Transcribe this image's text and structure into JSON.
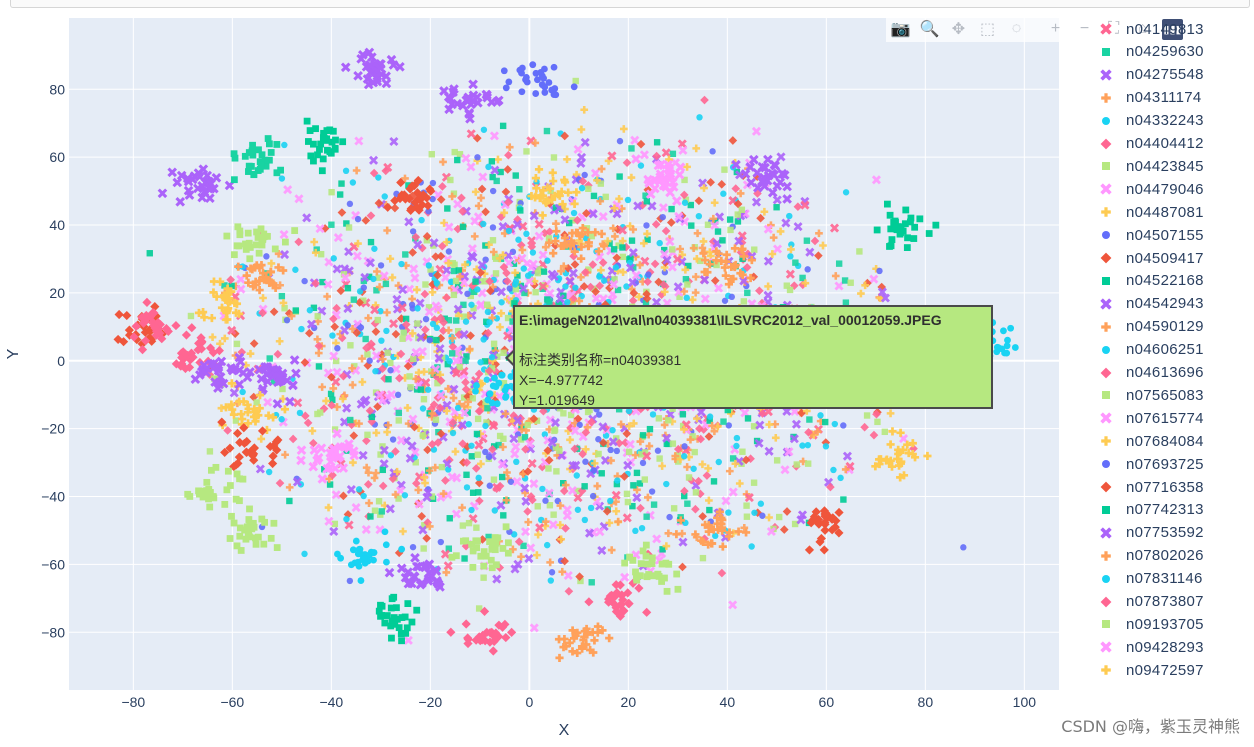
{
  "chart_data": {
    "type": "scatter",
    "xlabel": "X",
    "ylabel": "Y",
    "xlim": [
      -93,
      107
    ],
    "ylim": [
      -97,
      101
    ],
    "x_ticks": [
      -80,
      -60,
      -40,
      -20,
      0,
      20,
      40,
      60,
      80,
      100
    ],
    "y_ticks": [
      -80,
      -60,
      -40,
      -20,
      0,
      20,
      40,
      60,
      80
    ],
    "x_tick_labels": [
      "−80",
      "−60",
      "−40",
      "−20",
      "0",
      "20",
      "40",
      "60",
      "80",
      "100"
    ],
    "y_tick_labels": [
      "−80",
      "−60",
      "−40",
      "−20",
      "0",
      "20",
      "40",
      "60",
      "80"
    ],
    "grid": true,
    "legend_position": "right",
    "series": [
      {
        "name": "n04149813",
        "symbol": "x",
        "color": "#FF6692"
      },
      {
        "name": "n04259630",
        "symbol": "square",
        "color": "#19D3A2"
      },
      {
        "name": "n04275548",
        "symbol": "x",
        "color": "#AB63FA"
      },
      {
        "name": "n04311174",
        "symbol": "cross",
        "color": "#FFA15A"
      },
      {
        "name": "n04332243",
        "symbol": "circle",
        "color": "#19D3F3"
      },
      {
        "name": "n04404412",
        "symbol": "diamond",
        "color": "#FF6692"
      },
      {
        "name": "n04423845",
        "symbol": "square",
        "color": "#B6E880"
      },
      {
        "name": "n04479046",
        "symbol": "x",
        "color": "#FF97FF"
      },
      {
        "name": "n04487081",
        "symbol": "cross",
        "color": "#FECB52"
      },
      {
        "name": "n04507155",
        "symbol": "circle",
        "color": "#636EFA"
      },
      {
        "name": "n04509417",
        "symbol": "diamond",
        "color": "#EF553B"
      },
      {
        "name": "n04522168",
        "symbol": "square",
        "color": "#00CC96"
      },
      {
        "name": "n04542943",
        "symbol": "x",
        "color": "#AB63FA"
      },
      {
        "name": "n04590129",
        "symbol": "cross",
        "color": "#FFA15A"
      },
      {
        "name": "n04606251",
        "symbol": "circle",
        "color": "#19D3F3"
      },
      {
        "name": "n04613696",
        "symbol": "diamond",
        "color": "#FF6692"
      },
      {
        "name": "n07565083",
        "symbol": "square",
        "color": "#B6E880"
      },
      {
        "name": "n07615774",
        "symbol": "x",
        "color": "#FF97FF"
      },
      {
        "name": "n07684084",
        "symbol": "cross",
        "color": "#FECB52"
      },
      {
        "name": "n07693725",
        "symbol": "circle",
        "color": "#636EFA"
      },
      {
        "name": "n07716358",
        "symbol": "diamond",
        "color": "#EF553B"
      },
      {
        "name": "n07742313",
        "symbol": "square",
        "color": "#00CC96"
      },
      {
        "name": "n07753592",
        "symbol": "x",
        "color": "#AB63FA"
      },
      {
        "name": "n07802026",
        "symbol": "cross",
        "color": "#FFA15A"
      },
      {
        "name": "n07831146",
        "symbol": "circle",
        "color": "#19D3F3"
      },
      {
        "name": "n07873807",
        "symbol": "diamond",
        "color": "#FF6692"
      },
      {
        "name": "n09193705",
        "symbol": "square",
        "color": "#B6E880"
      },
      {
        "name": "n09428293",
        "symbol": "x",
        "color": "#FF97FF"
      },
      {
        "name": "n09472597",
        "symbol": "cross",
        "color": "#FECB52"
      }
    ],
    "clusters": [
      {
        "series": "n04509417",
        "x": -78,
        "y": 9
      },
      {
        "series": "n04613696",
        "x": -76,
        "y": 10
      },
      {
        "series": "n04404412",
        "x": -68,
        "y": 3
      },
      {
        "series": "n04275548",
        "x": -66,
        "y": 52
      },
      {
        "series": "n04259630",
        "x": -56,
        "y": 59
      },
      {
        "series": "n04522168",
        "x": -42,
        "y": 64
      },
      {
        "series": "n04275548",
        "x": -31,
        "y": 86
      },
      {
        "series": "n04507155",
        "x": 2,
        "y": 84
      },
      {
        "series": "n04275548",
        "x": -13,
        "y": 77
      },
      {
        "series": "n04509417",
        "x": -24,
        "y": 49
      },
      {
        "series": "n04423845",
        "x": -56,
        "y": 35
      },
      {
        "series": "n04311174",
        "x": -55,
        "y": 25
      },
      {
        "series": "n04487081",
        "x": -62,
        "y": 17
      },
      {
        "series": "n04542943",
        "x": -62,
        "y": -4
      },
      {
        "series": "n04542943",
        "x": -50,
        "y": -5
      },
      {
        "series": "n07684084",
        "x": -56,
        "y": -15
      },
      {
        "series": "n07716358",
        "x": -56,
        "y": -27
      },
      {
        "series": "n07565083",
        "x": -64,
        "y": -38
      },
      {
        "series": "n04423845",
        "x": -56,
        "y": -50
      },
      {
        "series": "n07615774",
        "x": -40,
        "y": -28
      },
      {
        "series": "n04332243",
        "x": -33,
        "y": -58
      },
      {
        "series": "n07753592",
        "x": -22,
        "y": -63
      },
      {
        "series": "n07742313",
        "x": -28,
        "y": -76
      },
      {
        "series": "n07873807",
        "x": -8,
        "y": -81
      },
      {
        "series": "n07802026",
        "x": 10,
        "y": -83
      },
      {
        "series": "n07873807",
        "x": 19,
        "y": -69
      },
      {
        "series": "n09193705",
        "x": 24,
        "y": -61
      },
      {
        "series": "n07716358",
        "x": 60,
        "y": -48
      },
      {
        "series": "n04311174",
        "x": 37,
        "y": -50
      },
      {
        "series": "n04522168",
        "x": 75,
        "y": 39
      },
      {
        "series": "n04275548",
        "x": 48,
        "y": 54
      },
      {
        "series": "n04479046",
        "x": 27,
        "y": 53
      },
      {
        "series": "n04311174",
        "x": 40,
        "y": 28
      },
      {
        "series": "n04332243",
        "x": 93,
        "y": 6
      },
      {
        "series": "n07684084",
        "x": 74,
        "y": -28
      },
      {
        "series": "n09193705",
        "x": -10,
        "y": -55
      },
      {
        "series": "n04606251",
        "x": -5,
        "y": -8
      },
      {
        "series": "n04590129",
        "x": 10,
        "y": 35
      },
      {
        "series": "n04487081",
        "x": 5,
        "y": 50
      }
    ],
    "hover": {
      "title": "E:\\imageN2012\\val\\n04039381\\ILSVRC2012_val_00012059.JPEG",
      "label_line": "标注类别名称=n04039381",
      "x_line": "X=−4.977742",
      "y_line": "Y=1.019649",
      "x": -4.977742,
      "y": 1.019649
    }
  },
  "modebar": {
    "buttons": [
      {
        "name": "camera-icon",
        "glyph": "📷"
      },
      {
        "name": "zoom-icon",
        "glyph": "🔍"
      },
      {
        "name": "pan-icon",
        "glyph": "✥"
      },
      {
        "name": "box-select-icon",
        "glyph": "⬚"
      },
      {
        "name": "lasso-select-icon",
        "glyph": "◌"
      },
      {
        "name": "zoom-in-icon",
        "glyph": "+"
      },
      {
        "name": "zoom-out-icon",
        "glyph": "−"
      },
      {
        "name": "autoscale-icon",
        "glyph": "⛶"
      },
      {
        "name": "reset-axes-icon",
        "glyph": "⌂"
      }
    ],
    "logo_glyph": "▮▮▮"
  },
  "watermark": "CSDN @嗨，紫玉灵神熊"
}
